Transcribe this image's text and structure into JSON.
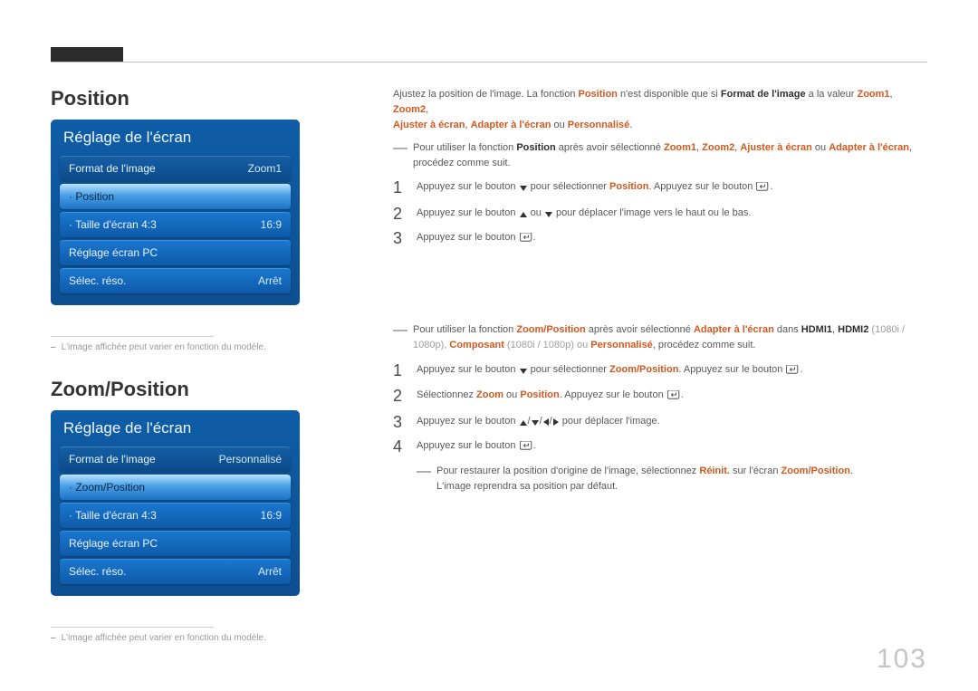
{
  "page_number": "103",
  "section1": {
    "title": "Position",
    "panel_title": "Réglage de l'écran",
    "rows": [
      {
        "label": "Format de l'image",
        "value": "Zoom1"
      },
      {
        "label": "Position",
        "value": ""
      },
      {
        "label": "Taille d'écran 4:3",
        "value": "16:9"
      },
      {
        "label": "Réglage écran PC",
        "value": ""
      },
      {
        "label": "Sélec. réso.",
        "value": "Arrêt"
      }
    ],
    "footnote": "L'image affichée peut varier en fonction du modèle.",
    "intro": {
      "pre": "Ajustez la position de l'image. La fonction ",
      "hl1": "Position",
      "mid": " n'est disponible que si ",
      "bold1": "Format de l'image",
      "mid2": " a la valeur ",
      "hl2": "Zoom1",
      "sep1": ", ",
      "hl3": "Zoom2",
      "sep2": ", ",
      "hl4": "Ajuster à écran",
      "sep3": ", ",
      "hl5": "Adapter à l'écran",
      "sep4": " ou ",
      "hl6": "Personnalisé",
      "end": "."
    },
    "tip": {
      "pre": "Pour utiliser la fonction ",
      "hl1": "Position",
      "mid": " après avoir sélectionné ",
      "hl2": "Zoom1",
      "sep1": ", ",
      "hl3": "Zoom2",
      "sep2": ", ",
      "hl4": "Ajuster à écran",
      "sep3": " ou ",
      "hl5": "Adapter à l'écran",
      "end": ", procédez comme suit."
    },
    "steps": [
      {
        "pre": "Appuyez sur le bouton ",
        "after_down": " pour sélectionner ",
        "hl": "Position",
        "post": ". Appuyez sur le bouton ",
        "icons": "down_enter"
      },
      {
        "pre": "Appuyez sur le bouton ",
        "post": " pour déplacer l'image vers le haut ou le bas.",
        "icons": "up_or_down"
      },
      {
        "pre": "Appuyez sur le bouton ",
        "post": ".",
        "icons": "enter"
      }
    ]
  },
  "section2": {
    "title": "Zoom/Position",
    "panel_title": "Réglage de l'écran",
    "rows": [
      {
        "label": "Format de l'image",
        "value": "Personnalisé"
      },
      {
        "label": "Zoom/Position",
        "value": ""
      },
      {
        "label": "Taille d'écran 4:3",
        "value": "16:9"
      },
      {
        "label": "Réglage écran PC",
        "value": ""
      },
      {
        "label": "Sélec. réso.",
        "value": "Arrêt"
      }
    ],
    "footnote": "L'image affichée peut varier en fonction du modèle.",
    "tip": {
      "pre": "Pour utiliser la fonction ",
      "hl1": "Zoom/Position",
      "mid": " après avoir sélectionné ",
      "hl2": "Adapter à l'écran",
      "mid2": " dans ",
      "bold1": "HDMI1",
      "sep1": ", ",
      "bold2": "HDMI2",
      "paren1": " (1080i / 1080p), ",
      "hl3": "Composant",
      "paren2": " (1080i / 1080p) ou ",
      "hl4": "Personnalisé",
      "end": ", procédez comme suit."
    },
    "steps": [
      {
        "pre": "Appuyez sur le bouton ",
        "after_down": " pour sélectionner ",
        "hl": "Zoom/Position",
        "post": ". Appuyez sur le bouton ",
        "icons": "down_enter"
      },
      {
        "pre": "Sélectionnez ",
        "hl": "Zoom",
        "mid": " ou ",
        "hl2": "Position",
        "post": ". Appuyez sur le bouton ",
        "icons": "select_enter"
      },
      {
        "pre": "Appuyez sur le bouton ",
        "post": " pour déplacer l'image.",
        "icons": "all_arrows"
      },
      {
        "pre": "Appuyez sur le bouton ",
        "post": ".",
        "icons": "enter"
      }
    ],
    "note": {
      "pre": "Pour restaurer la position d'origine de l'image, sélectionnez ",
      "hl1": "Réinit.",
      "mid": " sur l'écran ",
      "hl2": "Zoom/Position",
      "end": ".",
      "line2": "L'image reprendra sa position par défaut."
    }
  }
}
